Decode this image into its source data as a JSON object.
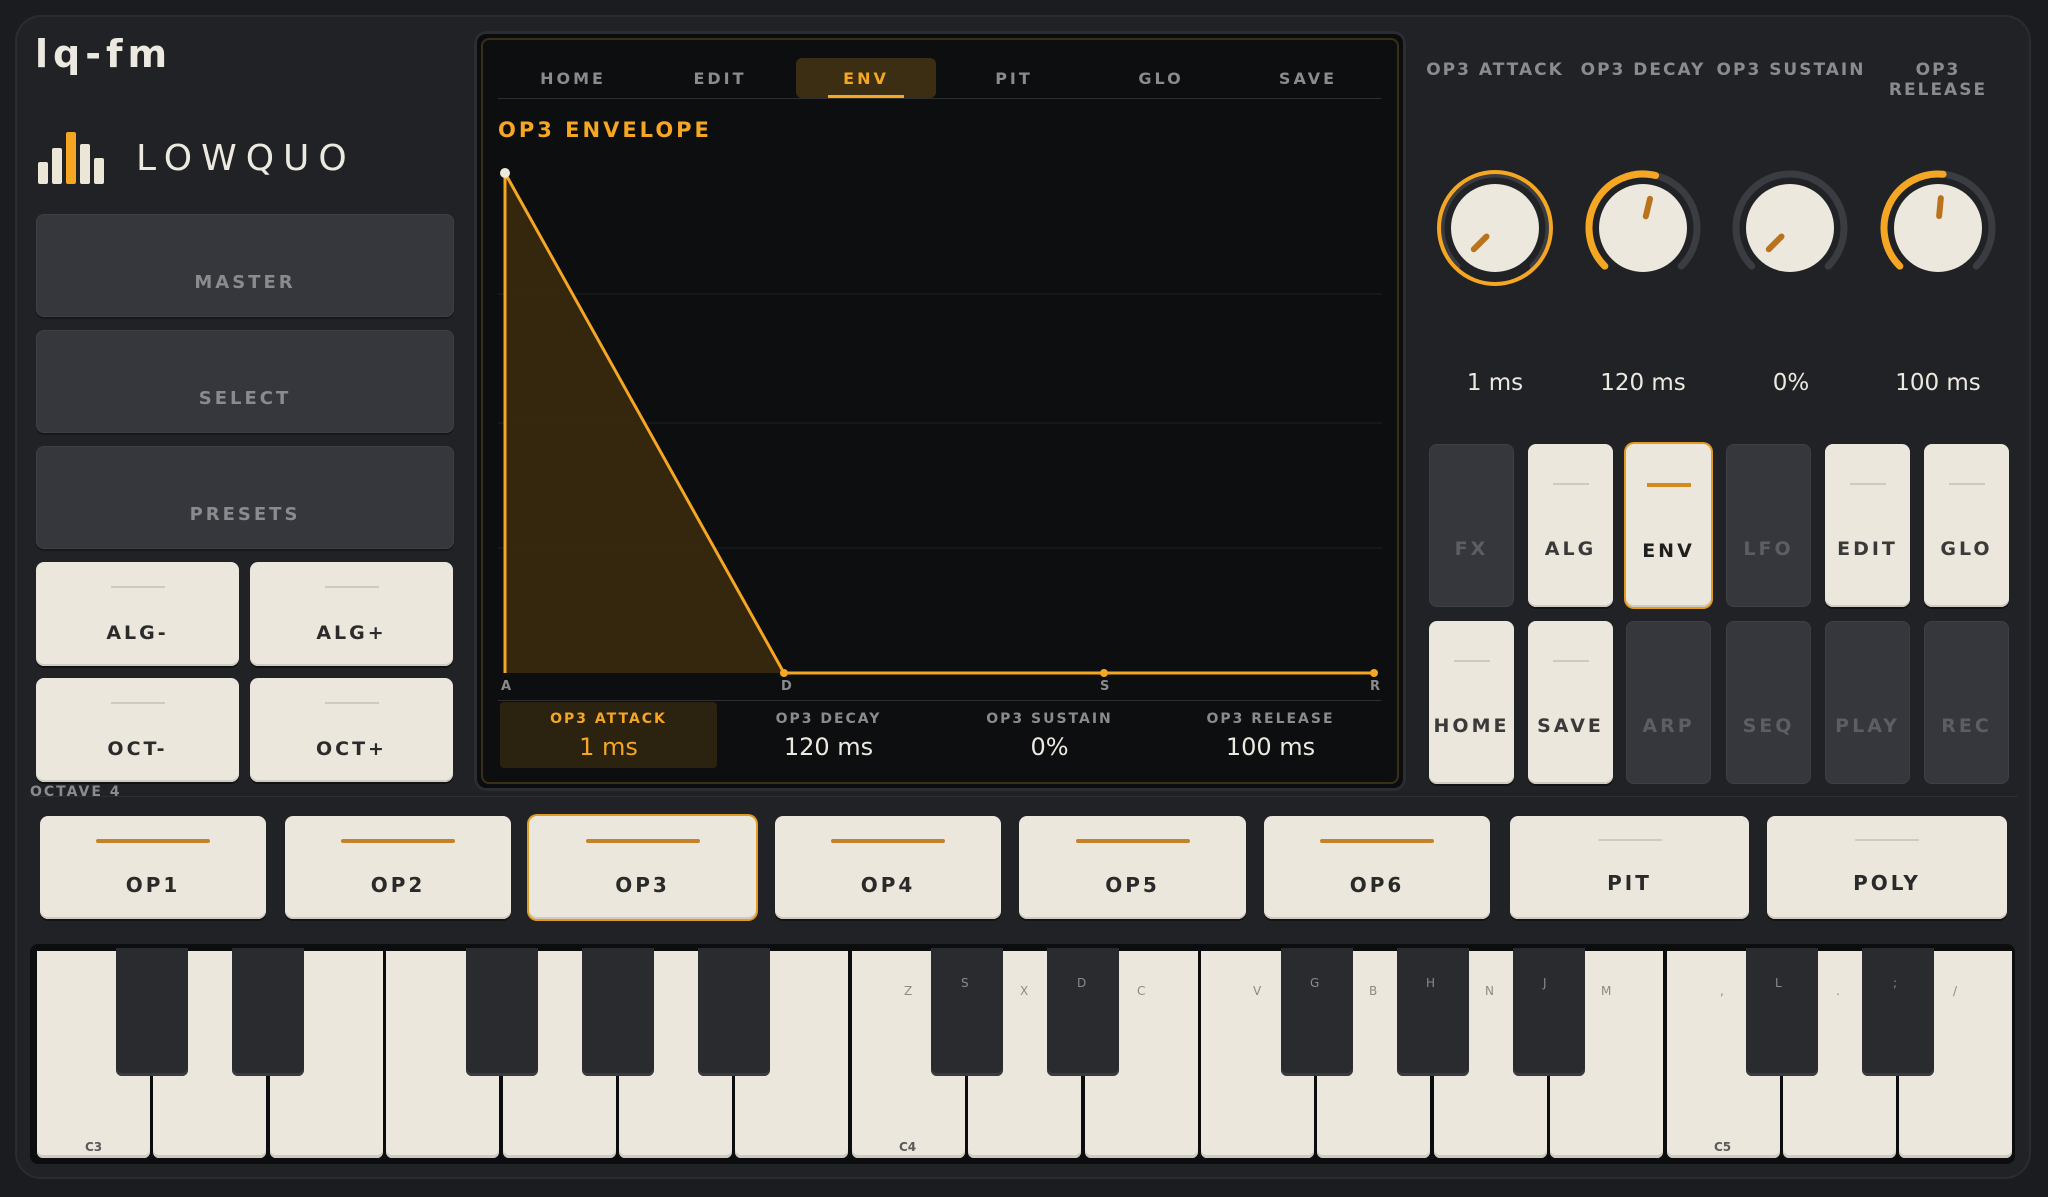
{
  "app": {
    "title": "lq-fm",
    "brand": "LOWQUO"
  },
  "left_buttons": {
    "master": "MASTER",
    "select": "SELECT",
    "presets": "PRESETS",
    "alg_minus": "ALG-",
    "alg_plus": "ALG+",
    "oct_minus": "OCT-",
    "oct_plus": "OCT+"
  },
  "octave_label": "OCTAVE 4",
  "tabs": [
    {
      "label": "HOME",
      "active": false
    },
    {
      "label": "EDIT",
      "active": false
    },
    {
      "label": "ENV",
      "active": true
    },
    {
      "label": "PIT",
      "active": false
    },
    {
      "label": "GLO",
      "active": false
    },
    {
      "label": "SAVE",
      "active": false
    }
  ],
  "envelope": {
    "title": "OP3  ENVELOPE",
    "point_labels": [
      "A",
      "D",
      "S",
      "R"
    ],
    "params": [
      {
        "name": "OP3 ATTACK",
        "value": "1 ms",
        "active": true
      },
      {
        "name": "OP3 DECAY",
        "value": "120 ms",
        "active": false
      },
      {
        "name": "OP3 SUSTAIN",
        "value": "0%",
        "active": false
      },
      {
        "name": "OP3 RELEASE",
        "value": "100 ms",
        "active": false
      }
    ]
  },
  "knobs": [
    {
      "label": "OP3 ATTACK",
      "value": "1 ms",
      "level": 0.0,
      "selected": true
    },
    {
      "label": "OP3 DECAY",
      "value": "120 ms",
      "level": 0.55,
      "selected": false
    },
    {
      "label": "OP3 SUSTAIN",
      "value": "0%",
      "level": 0.0,
      "selected": false
    },
    {
      "label": "OP3 RELEASE",
      "value": "100 ms",
      "level": 0.52,
      "selected": false
    }
  ],
  "pads_row1": [
    {
      "label": "FX",
      "state": "dark"
    },
    {
      "label": "ALG",
      "state": "light"
    },
    {
      "label": "ENV",
      "state": "active"
    },
    {
      "label": "LFO",
      "state": "dark"
    },
    {
      "label": "EDIT",
      "state": "light"
    },
    {
      "label": "GLO",
      "state": "light"
    }
  ],
  "pads_row2": [
    {
      "label": "HOME",
      "state": "light"
    },
    {
      "label": "SAVE",
      "state": "light"
    },
    {
      "label": "ARP",
      "state": "dark"
    },
    {
      "label": "SEQ",
      "state": "dark"
    },
    {
      "label": "PLAY",
      "state": "dark"
    },
    {
      "label": "REC",
      "state": "dark"
    }
  ],
  "operators": [
    {
      "label": "OP1",
      "enabled": true,
      "active": false
    },
    {
      "label": "OP2",
      "enabled": true,
      "active": false
    },
    {
      "label": "OP3",
      "enabled": true,
      "active": true
    },
    {
      "label": "OP4",
      "enabled": true,
      "active": false
    },
    {
      "label": "OP5",
      "enabled": true,
      "active": false
    },
    {
      "label": "OP6",
      "enabled": true,
      "active": false
    },
    {
      "label": "PIT",
      "enabled": false,
      "active": false
    },
    {
      "label": "POLY",
      "enabled": false,
      "active": false
    }
  ],
  "keyboard": {
    "note_labels": [
      "C3",
      "C4",
      "C5"
    ],
    "white_key_labels": [
      "Z",
      "X",
      "C",
      "V",
      "B",
      "N",
      "M",
      ",",
      ".",
      "/"
    ],
    "black_key_labels": [
      "S",
      "D",
      "G",
      "H",
      "J",
      "L",
      ";"
    ]
  },
  "colors": {
    "accent": "#f5a623",
    "panel": "#202226",
    "key_light": "#ebe7dc"
  }
}
